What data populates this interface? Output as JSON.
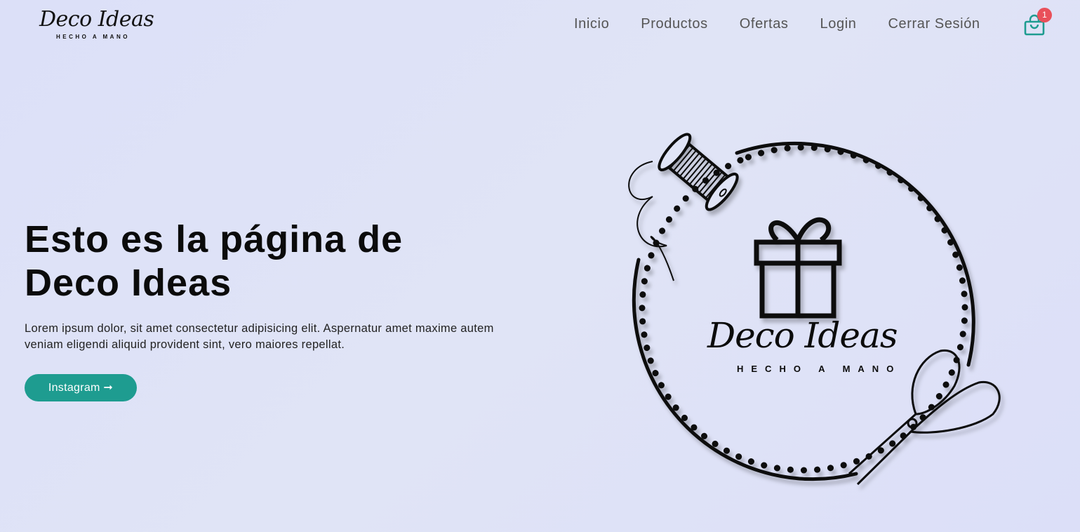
{
  "brand": {
    "name": "Deco Ideas",
    "tagline": "HECHO A MANO"
  },
  "nav": {
    "items": [
      {
        "label": "Inicio"
      },
      {
        "label": "Productos"
      },
      {
        "label": "Ofertas"
      },
      {
        "label": "Login"
      },
      {
        "label": "Cerrar Sesión"
      }
    ],
    "cart_icon": "shopping-bag-icon",
    "cart_count": "1"
  },
  "hero": {
    "title": "Esto es la página de Deco Ideas",
    "text": "Lorem ipsum dolor, sit amet consectetur adipisicing elit. Aspernatur amet maxime autem veniam eligendi aliquid provident sint, vero maiores repellat.",
    "button_label": "Instagram ➞"
  },
  "colors": {
    "background": "#dfe3f8",
    "accent": "#1e9c90",
    "badge": "#e9505a",
    "text": "#0b0b0b"
  }
}
